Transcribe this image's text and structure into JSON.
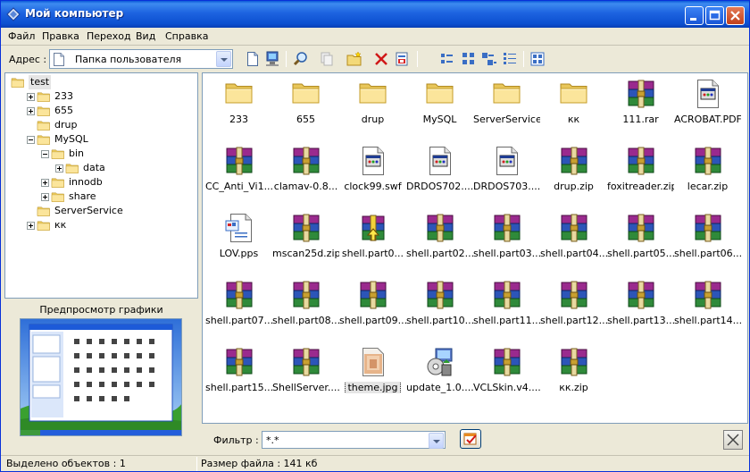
{
  "window": {
    "title": "Мой компьютер",
    "colors": {
      "titlebar": "#0a5ad8",
      "close": "#c2401b",
      "selection": "#e5e5e5"
    }
  },
  "menu": [
    "Файл",
    "Правка",
    "Переход",
    "Вид",
    "Справка"
  ],
  "address": {
    "label": "Адрес :",
    "value": "Папка пользователя"
  },
  "toolbar_icons": [
    "new-doc-icon",
    "computer-icon",
    "search-icon",
    "copy-icon",
    "new-folder-icon",
    "delete-icon",
    "properties-icon",
    "large-icons-view-icon",
    "small-icons-view-icon",
    "list-view-icon",
    "details-view-icon",
    "thumbnails-view-icon"
  ],
  "tree": [
    {
      "label": "test",
      "level": 0,
      "expander": "none",
      "selected": true
    },
    {
      "label": "233",
      "level": 1,
      "expander": "plus"
    },
    {
      "label": "655",
      "level": 1,
      "expander": "plus"
    },
    {
      "label": "drup",
      "level": 1,
      "expander": "none"
    },
    {
      "label": "MySQL",
      "level": 1,
      "expander": "minus"
    },
    {
      "label": "bin",
      "level": 2,
      "expander": "minus"
    },
    {
      "label": "data",
      "level": 3,
      "expander": "plus"
    },
    {
      "label": "innodb",
      "level": 2,
      "expander": "plus"
    },
    {
      "label": "share",
      "level": 2,
      "expander": "plus"
    },
    {
      "label": "ServerService",
      "level": 1,
      "expander": "none"
    },
    {
      "label": "кк",
      "level": 1,
      "expander": "plus"
    }
  ],
  "preview": {
    "title": "Предпросмотр графики"
  },
  "files": [
    {
      "name": "233",
      "type": "folder"
    },
    {
      "name": "655",
      "type": "folder"
    },
    {
      "name": "drup",
      "type": "folder"
    },
    {
      "name": "MySQL",
      "type": "folder"
    },
    {
      "name": "ServerService",
      "type": "folder"
    },
    {
      "name": "кк",
      "type": "folder"
    },
    {
      "name": "111.rar",
      "type": "rar"
    },
    {
      "name": "ACROBAT.PDF",
      "type": "doc"
    },
    {
      "name": "CC_Anti_Vi1...",
      "type": "rar"
    },
    {
      "name": "clamav-0.8...",
      "type": "rar"
    },
    {
      "name": "clock99.swf",
      "type": "doc"
    },
    {
      "name": "DRDOS702....",
      "type": "doc"
    },
    {
      "name": "DRDOS703....",
      "type": "doc"
    },
    {
      "name": "drup.zip",
      "type": "rar"
    },
    {
      "name": "foxitreader.zip",
      "type": "rar"
    },
    {
      "name": "lecar.zip",
      "type": "rar"
    },
    {
      "name": "LOV.pps",
      "type": "pps"
    },
    {
      "name": "mscan25d.zip",
      "type": "rar"
    },
    {
      "name": "shell.part0...",
      "type": "sfx"
    },
    {
      "name": "shell.part02...",
      "type": "rar"
    },
    {
      "name": "shell.part03....",
      "type": "rar"
    },
    {
      "name": "shell.part04....",
      "type": "rar"
    },
    {
      "name": "shell.part05....",
      "type": "rar"
    },
    {
      "name": "shell.part06....",
      "type": "rar"
    },
    {
      "name": "shell.part07....",
      "type": "rar"
    },
    {
      "name": "shell.part08....",
      "type": "rar"
    },
    {
      "name": "shell.part09....",
      "type": "rar"
    },
    {
      "name": "shell.part10....",
      "type": "rar"
    },
    {
      "name": "shell.part11....",
      "type": "rar"
    },
    {
      "name": "shell.part12....",
      "type": "rar"
    },
    {
      "name": "shell.part13....",
      "type": "rar"
    },
    {
      "name": "shell.part14....",
      "type": "rar"
    },
    {
      "name": "shell.part15....",
      "type": "rar"
    },
    {
      "name": "ShellServer....",
      "type": "rar"
    },
    {
      "name": "theme.jpg",
      "type": "jpg",
      "selected": true
    },
    {
      "name": "update_1.0....",
      "type": "installer"
    },
    {
      "name": "VCLSkin.v4....",
      "type": "rar"
    },
    {
      "name": "кк.zip",
      "type": "rar"
    }
  ],
  "filter": {
    "label": "Фильтр :",
    "value": "*.*"
  },
  "status": {
    "selected": "Выделено объектов : 1",
    "size": "Размер файла : 141 кб"
  }
}
